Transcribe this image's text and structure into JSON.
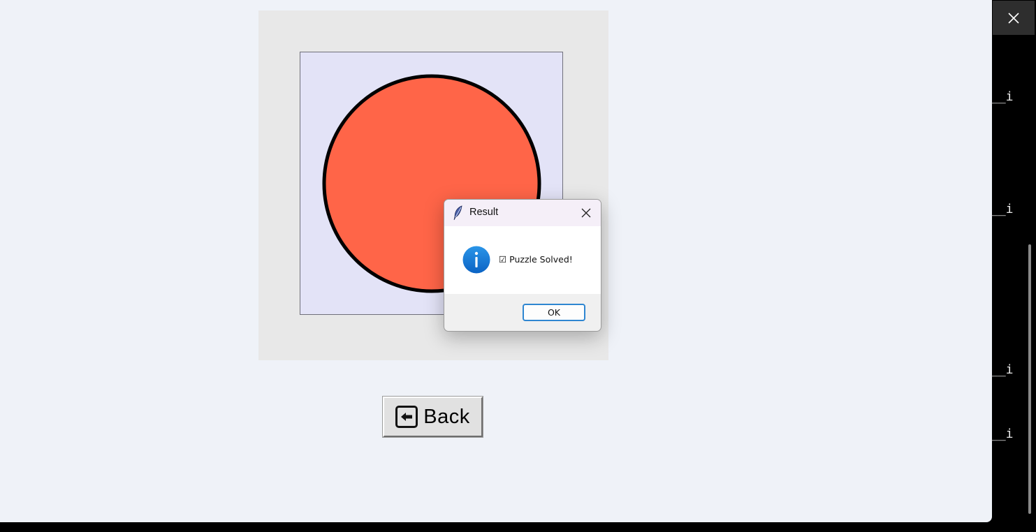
{
  "main_window": {
    "back_button_label": "Back",
    "circle_color": "#ff6548",
    "board_color": "#e3e3f7"
  },
  "dialog": {
    "title": "Result",
    "message": "☑ Puzzle Solved!",
    "ok_label": "OK",
    "icon": "info-icon",
    "accent_color": "#1478d2"
  },
  "side_terminal": {
    "lines": [
      "__i",
      "__i",
      "__i",
      "__i"
    ]
  }
}
